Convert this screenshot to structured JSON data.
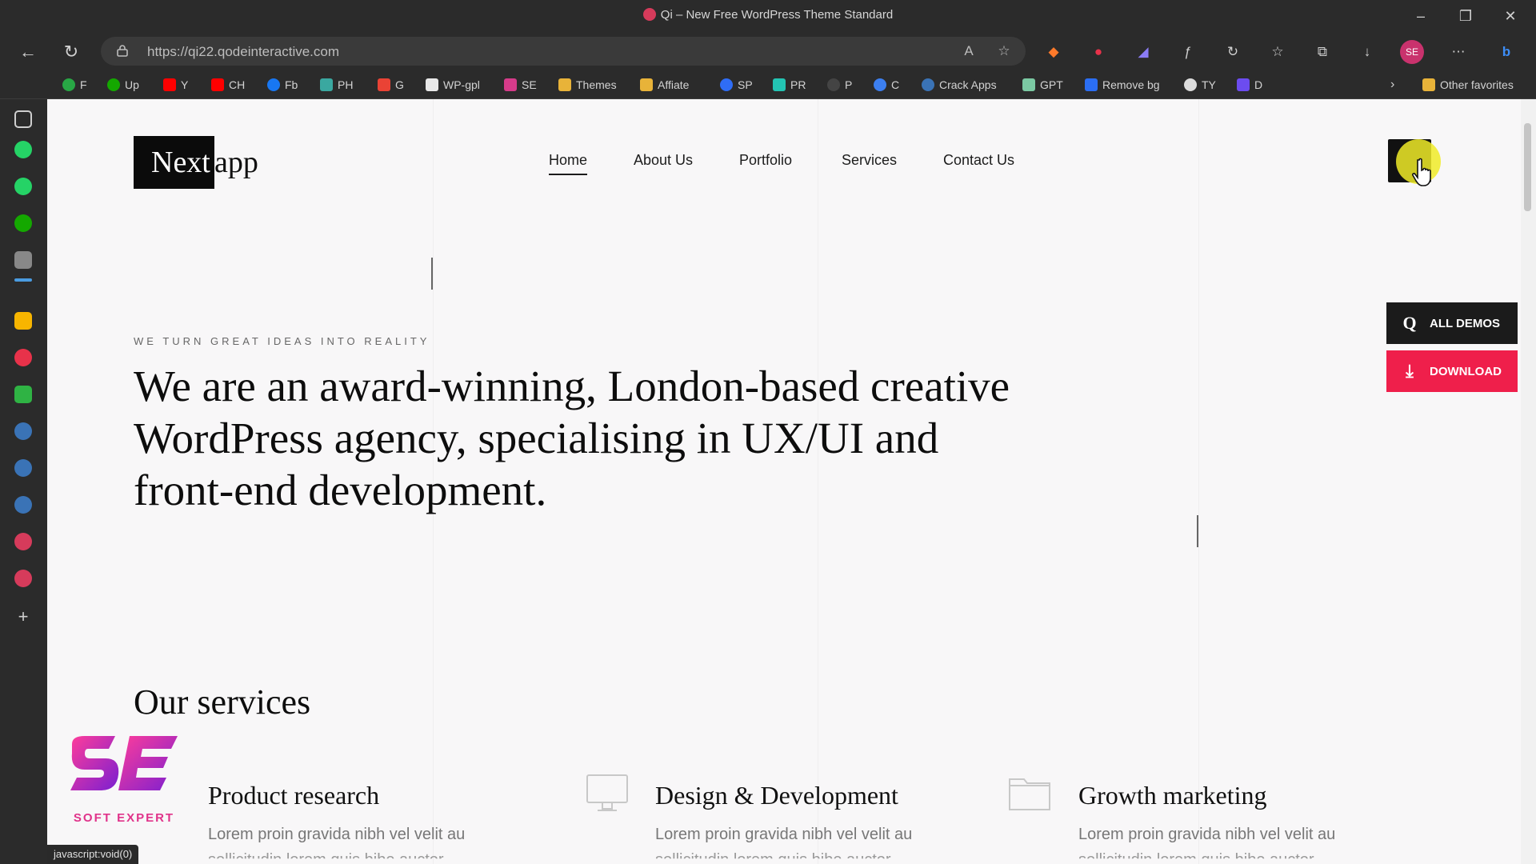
{
  "browser": {
    "window_title": "Qi – New Free WordPress Theme Standard",
    "url": "https://qi22.qodeinteractive.com",
    "bookmarks": [
      "F",
      "Up",
      "Y",
      "CH",
      "Fb",
      "PH",
      "G",
      "WP-gpl",
      "SE",
      "Themes",
      "Affiate",
      "SP",
      "PR",
      "P",
      "C",
      "Crack Apps",
      "GPT",
      "Remove bg",
      "TY",
      "D"
    ],
    "other_favorites": "Other favorites",
    "status_text": "javascript:void(0)"
  },
  "site": {
    "logo_dark": "Next",
    "logo_light": "app",
    "nav": [
      "Home",
      "About Us",
      "Portfolio",
      "Services",
      "Contact Us"
    ],
    "all_demos": "ALL DEMOS",
    "download": "DOWNLOAD",
    "tagline": "WE TURN GREAT IDEAS INTO REALITY",
    "hero": "We are an award-winning, London-based creative WordPress agency, specialising in UX/UI and front-end development.",
    "services_title": "Our services",
    "services": [
      {
        "title": "Product research",
        "desc": "Lorem proin gravida nibh vel velit au",
        "desc2": "sollicitudin lorem quis bibe auctor"
      },
      {
        "title": "Design & Development",
        "desc": "Lorem proin gravida nibh vel velit au",
        "desc2": "sollicitudin lorem quis bibe auctor"
      },
      {
        "title": "Growth marketing",
        "desc": "Lorem proin gravida nibh vel velit au",
        "desc2": "sollicitudin lorem quis bibe auctor"
      }
    ],
    "watermark": "SOFT EXPERT"
  },
  "colors": {
    "download_button": "#ef1f4b",
    "all_demos_button": "#1b1b1b",
    "cursor_highlight": "#f0eb28"
  }
}
